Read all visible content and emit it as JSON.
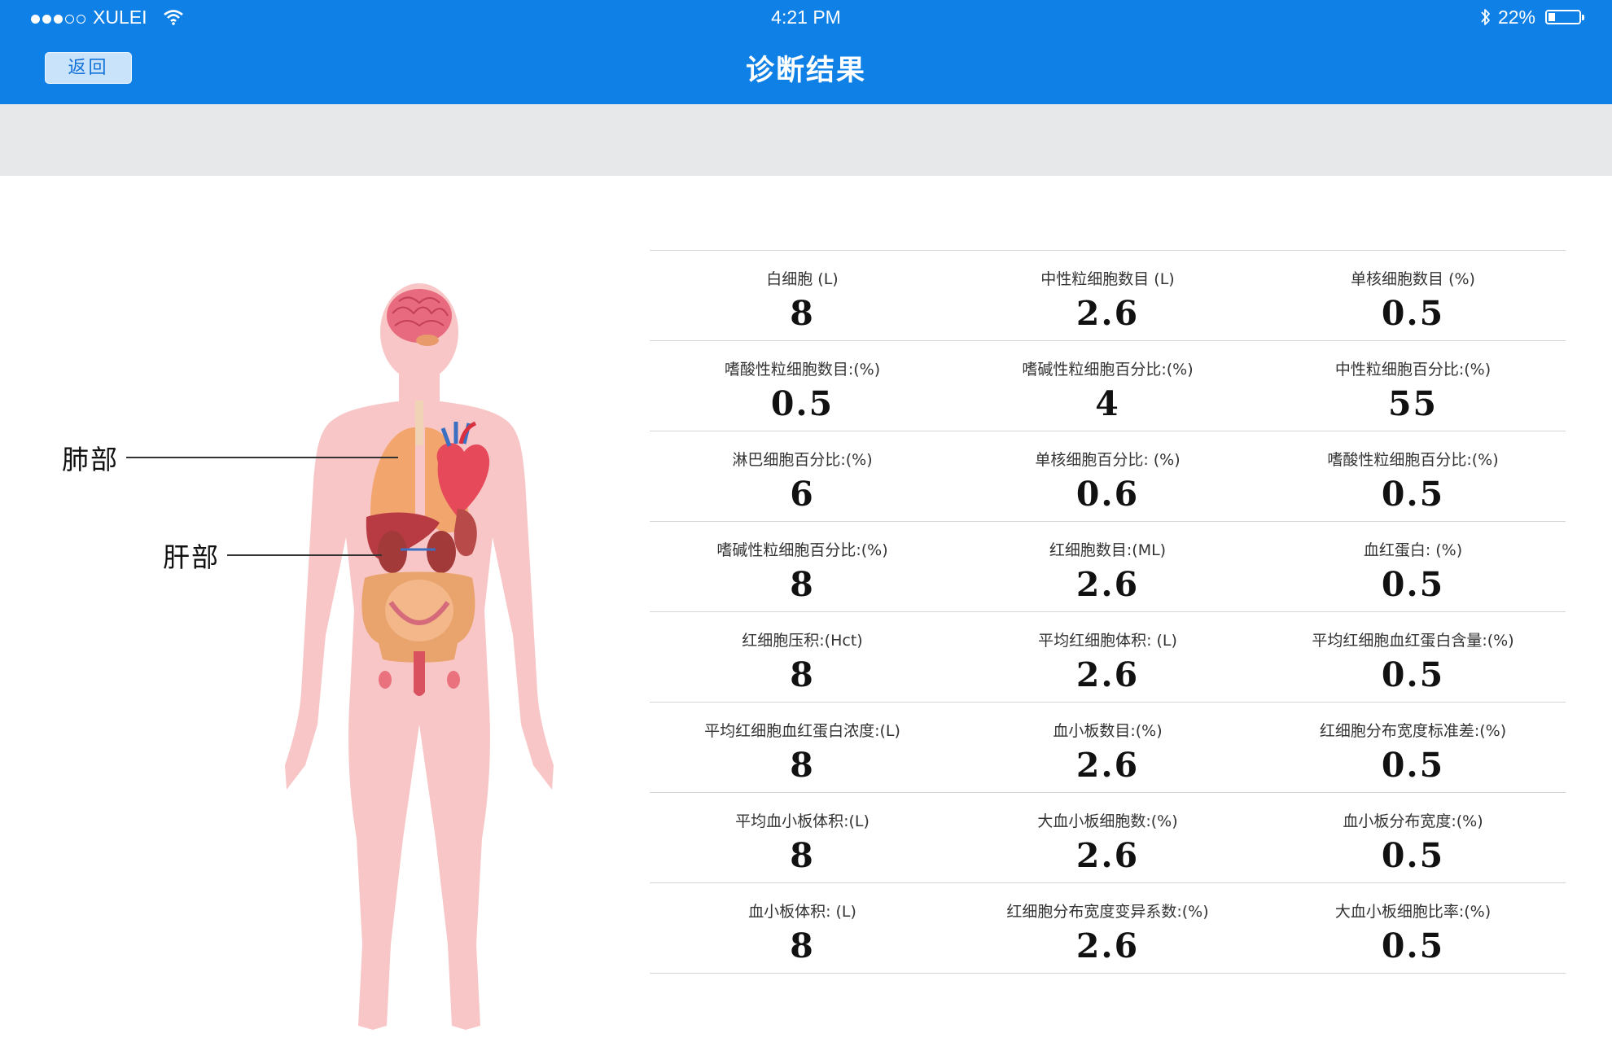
{
  "status_bar": {
    "carrier": "XULEI",
    "time": "4:21 PM",
    "battery": "22%",
    "battery_level": 0.22,
    "signal_bars_filled": 3,
    "signal_bars_total": 5,
    "icons": [
      "signal-dots-icon",
      "wifi-icon",
      "bluetooth-icon",
      "battery-icon"
    ]
  },
  "header": {
    "back_label": "返回",
    "title": "诊断结果"
  },
  "figure": {
    "labels": {
      "lung": "肺部",
      "liver": "肝部"
    }
  },
  "colors": {
    "header_bg": "#0f80e6",
    "band_bg": "#e7e8ea",
    "skin": "#f8c6c6"
  },
  "results": [
    [
      {
        "label": "白细胞 (L)",
        "value": "8"
      },
      {
        "label": "中性粒细胞数目 (L)",
        "value": "2.6"
      },
      {
        "label": "单核细胞数目 (%)",
        "value": "0.5"
      }
    ],
    [
      {
        "label": "嗜酸性粒细胞数目:(%)",
        "value": "0.5"
      },
      {
        "label": "嗜碱性粒细胞百分比:(%)",
        "value": "4"
      },
      {
        "label": "中性粒细胞百分比:(%)",
        "value": "55"
      }
    ],
    [
      {
        "label": "淋巴细胞百分比:(%)",
        "value": "6"
      },
      {
        "label": "单核细胞百分比: (%)",
        "value": "0.6"
      },
      {
        "label": "嗜酸性粒细胞百分比:(%)",
        "value": "0.5"
      }
    ],
    [
      {
        "label": "嗜碱性粒细胞百分比:(%)",
        "value": "8"
      },
      {
        "label": "红细胞数目:(ML)",
        "value": "2.6"
      },
      {
        "label": "血红蛋白: (%)",
        "value": "0.5"
      }
    ],
    [
      {
        "label": "红细胞压积:(Hct)",
        "value": "8"
      },
      {
        "label": "平均红细胞体积: (L)",
        "value": "2.6"
      },
      {
        "label": "平均红细胞血红蛋白含量:(%)",
        "value": "0.5"
      }
    ],
    [
      {
        "label": "平均红细胞血红蛋白浓度:(L)",
        "value": "8"
      },
      {
        "label": "血小板数目:(%)",
        "value": "2.6"
      },
      {
        "label": "红细胞分布宽度标准差:(%)",
        "value": "0.5"
      }
    ],
    [
      {
        "label": "平均血小板体积:(L)",
        "value": "8"
      },
      {
        "label": "大血小板细胞数:(%)",
        "value": "2.6"
      },
      {
        "label": "血小板分布宽度:(%)",
        "value": "0.5"
      }
    ],
    [
      {
        "label": "血小板体积: (L)",
        "value": "8"
      },
      {
        "label": "红细胞分布宽度变异系数:(%)",
        "value": "2.6"
      },
      {
        "label": "大血小板细胞比率:(%)",
        "value": "0.5"
      }
    ]
  ]
}
